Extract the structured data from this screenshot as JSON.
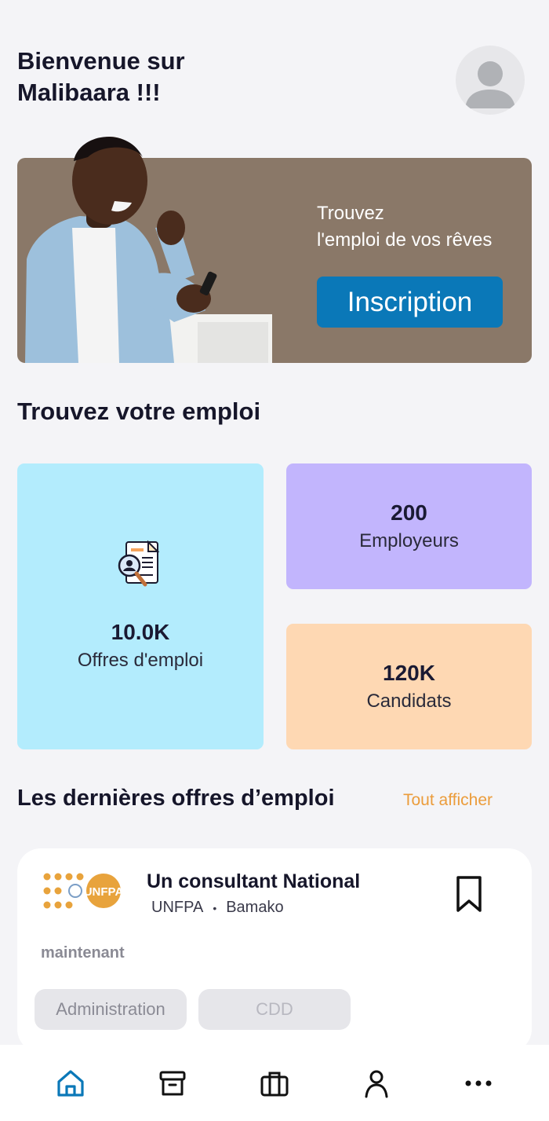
{
  "header": {
    "welcome_line1": "Bienvenue sur",
    "welcome_line2": "Malibaara !!!"
  },
  "banner": {
    "text_line1": "Trouvez",
    "text_line2": "l'emploi de vos rêves",
    "button_label": "Inscription"
  },
  "section_find": {
    "title": "Trouvez votre emploi"
  },
  "stats": {
    "offres": {
      "value": "10.0K",
      "label": "Offres d'emploi",
      "icon": "job-document-search-icon"
    },
    "employeurs": {
      "value": "200",
      "label": "Employeurs"
    },
    "candidats": {
      "value": "120K",
      "label": "Candidats"
    }
  },
  "latest": {
    "title": "Les dernières offres d’emploi",
    "see_all_label": "Tout afficher",
    "jobs": [
      {
        "logo_text": "UNFPA",
        "title": "Un consultant National",
        "company": "UNFPA",
        "location": "Bamako",
        "posted": "maintenant",
        "tags": [
          "Administration",
          "CDD"
        ]
      }
    ]
  },
  "bottom_nav": {
    "items": [
      "home-icon",
      "archive-icon",
      "briefcase-icon",
      "user-icon",
      "more-icon"
    ],
    "active": "home-icon"
  },
  "colors": {
    "accent": "#0a78b8",
    "link": "#eb9c3b",
    "card_offres": "#b3ecfd",
    "card_employeurs": "#c2b5fd",
    "card_candidats": "#fed8b3",
    "banner": "#8a7868"
  }
}
